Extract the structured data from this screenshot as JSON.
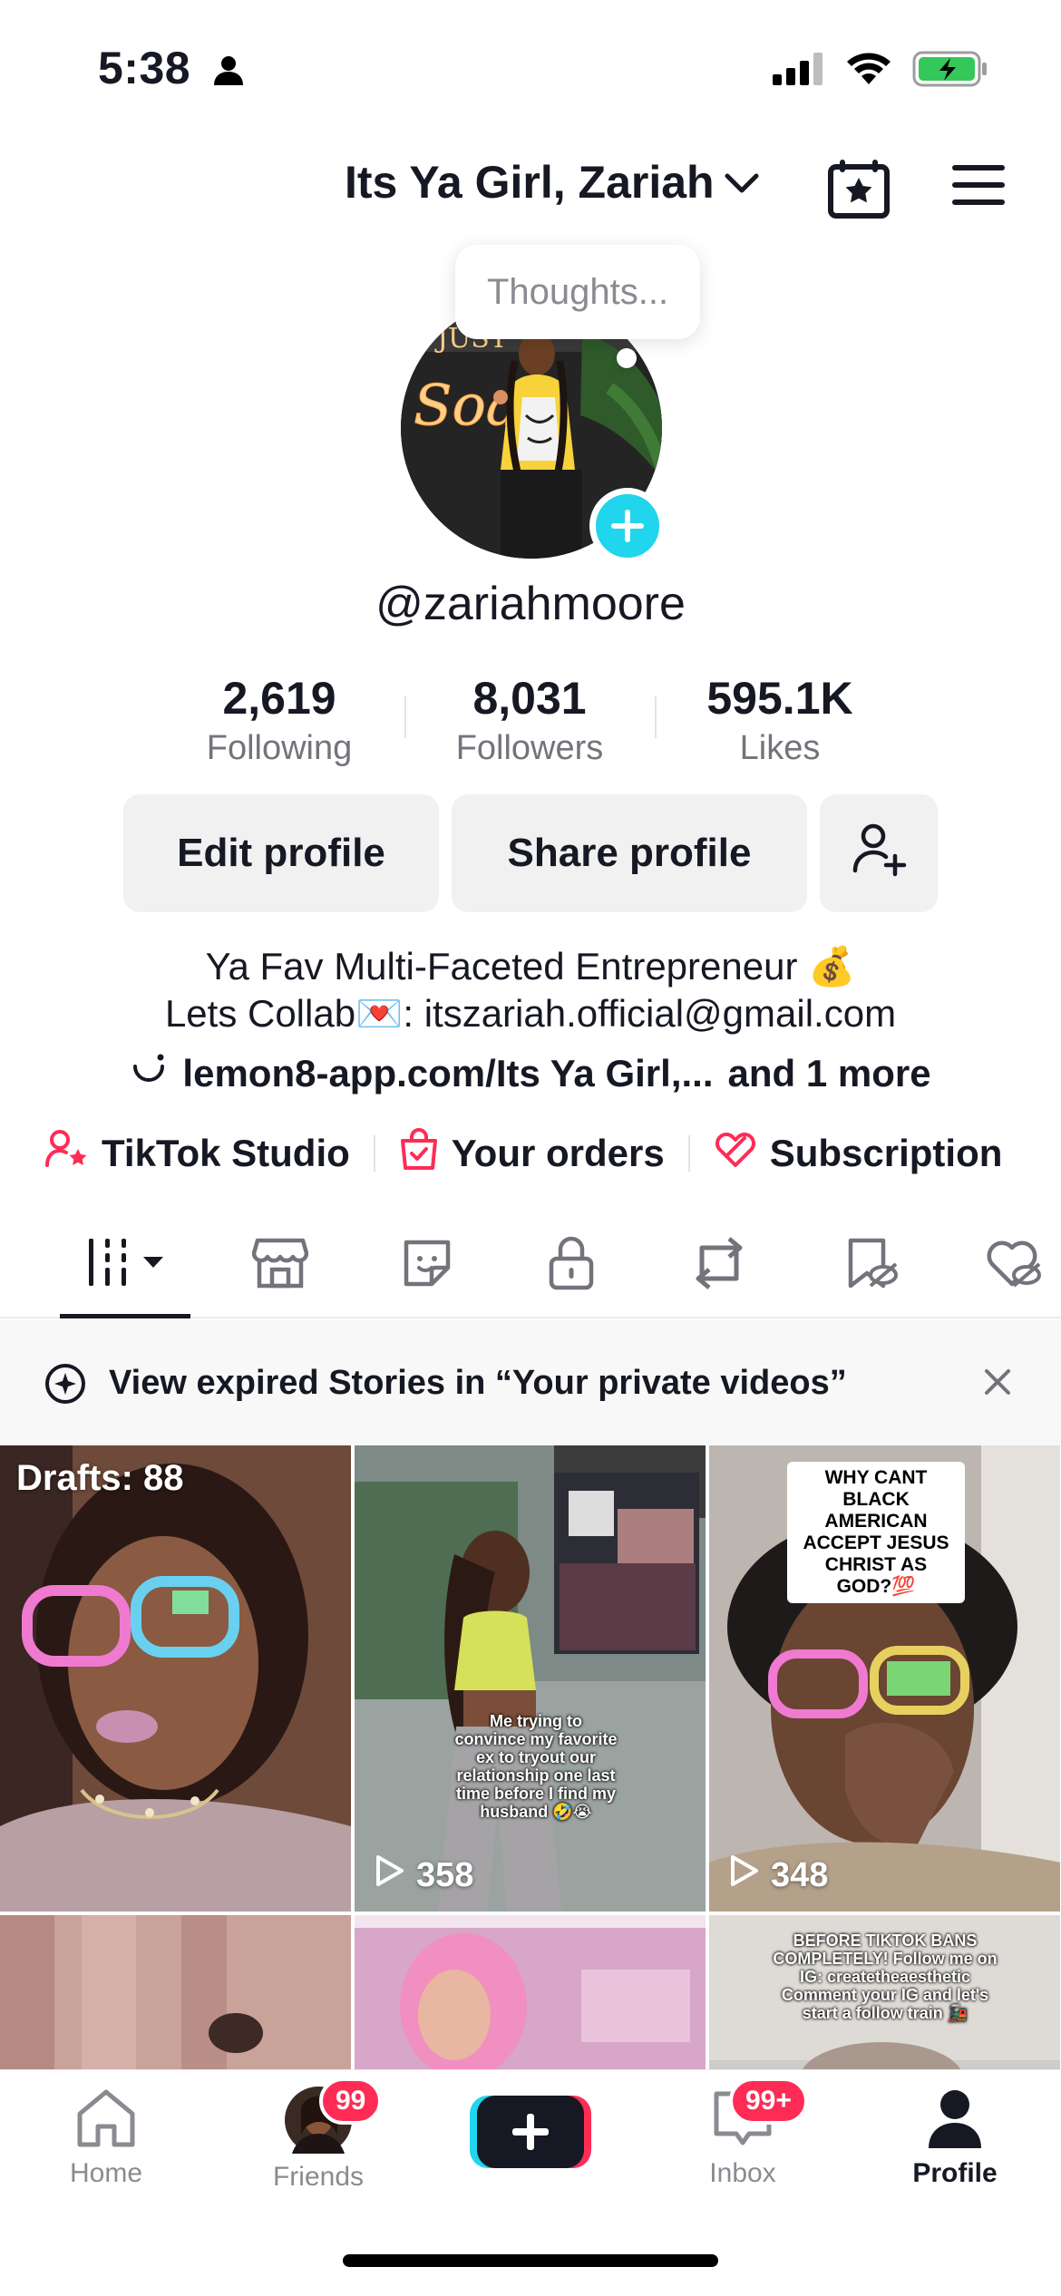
{
  "status_bar": {
    "time": "5:38"
  },
  "header": {
    "title": "Its Ya Girl, Zariah"
  },
  "avatar": {
    "thought": "Thoughts..."
  },
  "profile": {
    "username": "@zariahmoore"
  },
  "stats": [
    {
      "value": "2,619",
      "label": "Following"
    },
    {
      "value": "8,031",
      "label": "Followers"
    },
    {
      "value": "595.1K",
      "label": "Likes"
    }
  ],
  "buttons": {
    "edit": "Edit profile",
    "share": "Share profile"
  },
  "bio": {
    "line1": "Ya Fav Multi-Faceted Entrepreneur 💰",
    "line2": "Lets Collab💌: itszariah.official@gmail.com",
    "link": "lemon8-app.com/Its Ya Girl,...",
    "link_more": "and 1 more"
  },
  "quick_links": {
    "studio": "TikTok Studio",
    "orders": "Your orders",
    "subscription": "Subscription"
  },
  "notice": {
    "text": "View expired Stories in “Your private videos”"
  },
  "grid": {
    "drafts": "Drafts: 88",
    "v2_caption": "Me trying to convince my favorite ex to tryout our relationship one last time before I find my husband 🤣😭",
    "v2_views": "358",
    "v3_caption": "WHY CANT BLACK AMERICAN ACCEPT JESUS CHRIST AS GOD?💯",
    "v3_views": "348",
    "v6_caption": "BEFORE TIKTOK BANS COMPLETELY! Follow me on IG: createtheaesthetic Comment your IG and let's start a follow train 🚂"
  },
  "bottom_nav": {
    "home": "Home",
    "friends": "Friends",
    "friends_badge": "99",
    "inbox": "Inbox",
    "inbox_badge": "99+",
    "profile": "Profile"
  },
  "colors": {
    "accent": "#fe2c55",
    "cyan": "#20d5ec",
    "text": "#161823",
    "muted": "#73747b"
  }
}
